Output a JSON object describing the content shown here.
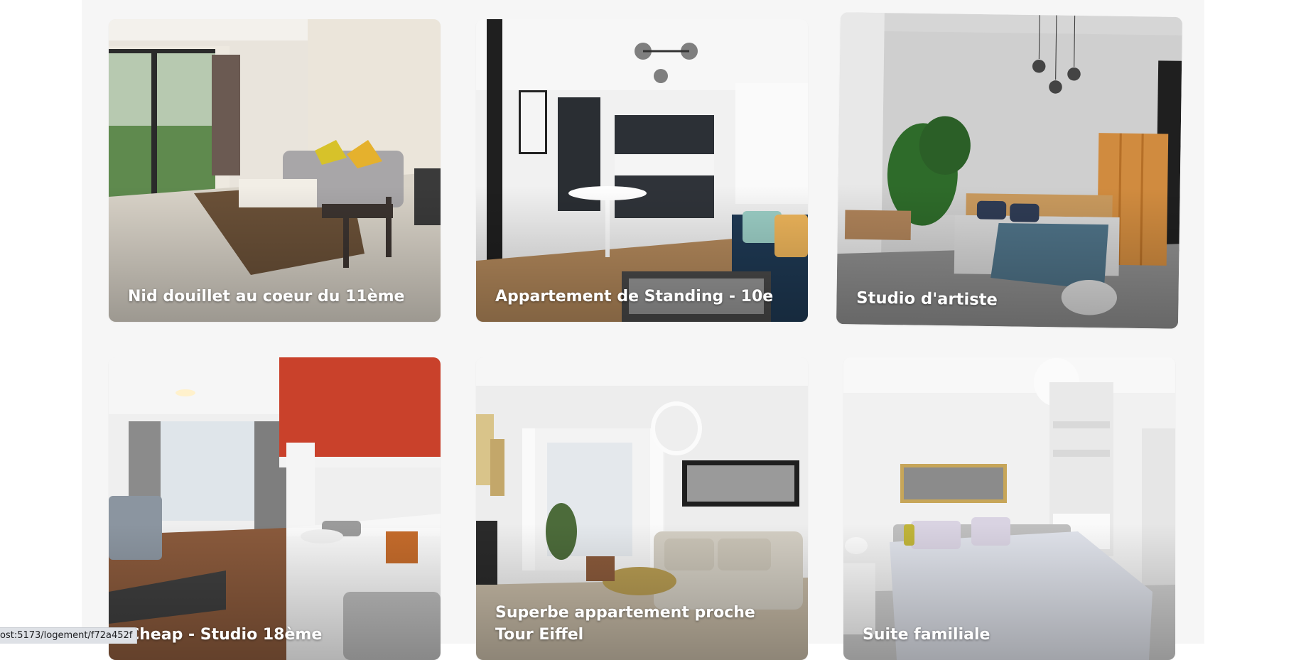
{
  "gallery": {
    "cards": [
      {
        "title": "Nid douillet au coeur du 11ème"
      },
      {
        "title": "Appartement de Standing - 10e"
      },
      {
        "title": "Studio d'artiste"
      },
      {
        "title": "Cheap - Studio 18ème"
      },
      {
        "title": "Superbe appartement proche Tour Eiffel"
      },
      {
        "title": "Suite familiale"
      }
    ]
  },
  "status_bar": {
    "url": "ost:5173/logement/f72a452f"
  }
}
